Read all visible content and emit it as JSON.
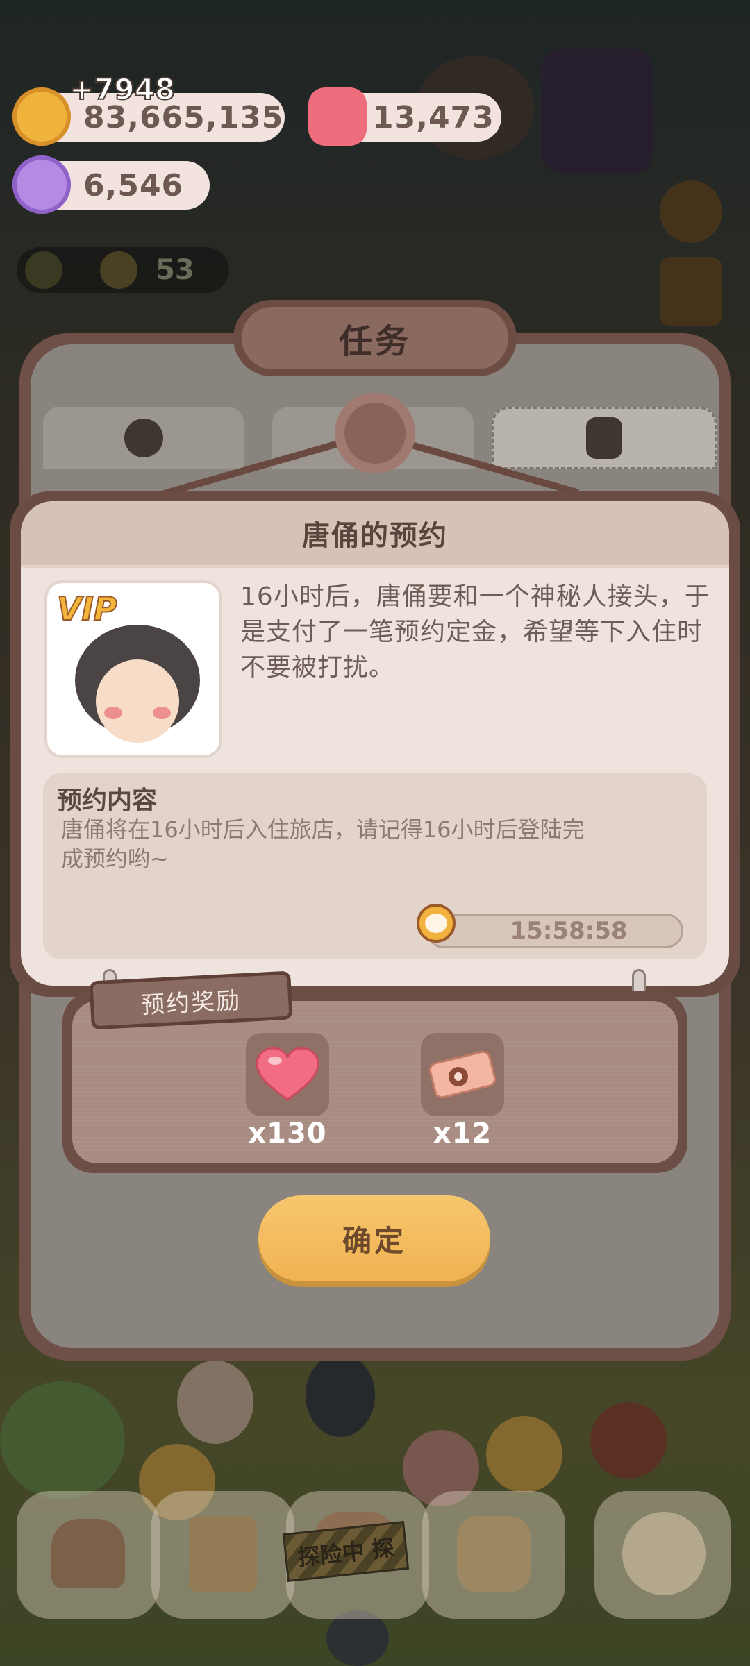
{
  "resources": {
    "coins": {
      "icon": "cookie-coin-icon",
      "value": "83,665,135",
      "delta": "+7948"
    },
    "candles": {
      "icon": "candle-icon",
      "value": "13,473"
    },
    "gems": {
      "icon": "crystal-candy-icon",
      "value": "6,546"
    },
    "level": {
      "icon": "sun-icon",
      "value": "53"
    }
  },
  "panel": {
    "title": "任务",
    "tabs": [
      {
        "icon": "badge-paw-icon"
      },
      {
        "icon": "tab-middle-icon"
      },
      {
        "icon": "flower-bag-icon",
        "active": true
      }
    ]
  },
  "popup": {
    "title": "唐俑的预约",
    "avatar_badge": "VIP",
    "description": "16小时后，唐俑要和一个神秘人接头，于是支付了一笔预约定金，希望等下入住时不要被打扰。",
    "detail_title": "预约内容",
    "detail_text": "唐俑将在16小时后入住旅店，请记得16小时后登陆完成预约哟~",
    "timer": "15:58:58"
  },
  "rewards": {
    "label": "预约奖励",
    "items": [
      {
        "icon": "heart-icon",
        "qty": "x130"
      },
      {
        "icon": "ticket-icon",
        "qty": "x12"
      }
    ]
  },
  "confirm_label": "确定",
  "bottom_nav": {
    "items": [
      {
        "icon": "mushroom-house-icon"
      },
      {
        "icon": "notebook-icon"
      },
      {
        "icon": "explore-icon",
        "label": "探险中 探"
      },
      {
        "icon": "shop-icon"
      },
      {
        "icon": "fish-alarm-icon"
      }
    ]
  },
  "colors": {
    "card_bg": "#efe3dd",
    "panel_border": "#6e5049",
    "confirm_button": "#f1b251",
    "reward_bg": "#a88c82"
  }
}
